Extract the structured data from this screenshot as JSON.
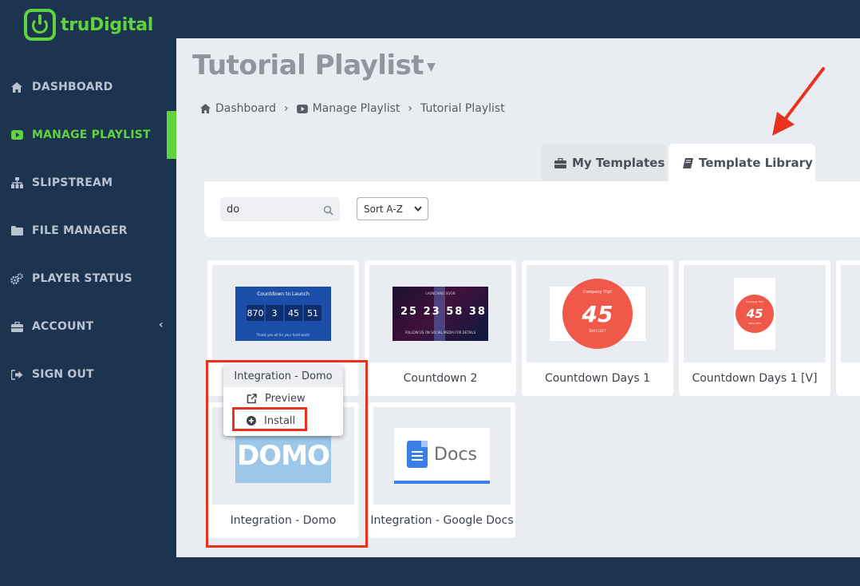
{
  "brand": {
    "name": "truDigital",
    "accent": "#5fd43c"
  },
  "sidebar": {
    "items": [
      {
        "label": "DASHBOARD",
        "icon": "home-icon"
      },
      {
        "label": "MANAGE PLAYLIST",
        "icon": "play-icon",
        "active": true
      },
      {
        "label": "SLIPSTREAM",
        "icon": "sitemap-icon"
      },
      {
        "label": "FILE MANAGER",
        "icon": "folder-icon"
      },
      {
        "label": "PLAYER STATUS",
        "icon": "gears-icon"
      },
      {
        "label": "ACCOUNT",
        "icon": "briefcase-icon",
        "expand": "‹"
      },
      {
        "label": "SIGN OUT",
        "icon": "sign-out-icon"
      }
    ]
  },
  "page": {
    "title": "Tutorial Playlist",
    "breadcrumb": [
      "Dashboard",
      "Manage Playlist",
      "Tutorial Playlist"
    ]
  },
  "tabs": {
    "my_templates": "My Templates",
    "template_library": "Template Library"
  },
  "filters": {
    "search_value": "do",
    "sort_value": "Sort A-Z"
  },
  "templates": [
    {
      "label": "Countdown to Launch",
      "thumb": {
        "title": "Countdown to Launch",
        "numbers": [
          "870",
          "3",
          "45",
          "51"
        ],
        "footer": "Thank you all for your hard work!"
      }
    },
    {
      "label": "Countdown 2",
      "thumb": {
        "top": "LAUNCHING SOON",
        "numbers": "25 23 58 38",
        "bottom": "FOLLOW US ON SOCIAL MEDIA FOR DETAILS"
      }
    },
    {
      "label": "Countdown Days 1",
      "thumb": {
        "company": "Company Trip!",
        "number": "45",
        "caption": "DAYS LEFT"
      }
    },
    {
      "label": "Countdown Days 1 [V]",
      "thumb": {
        "company": "Company Trip!",
        "number": "45",
        "caption": "DAYS LEFT"
      }
    },
    {
      "label": "Integration - Domo",
      "thumb": {
        "logo_text": "DOMO"
      }
    },
    {
      "label": "Integration - Google Docs",
      "thumb": {
        "logo_text": "Docs"
      }
    }
  ],
  "popup": {
    "title": "Integration - Domo",
    "preview": "Preview",
    "install": "Install"
  }
}
